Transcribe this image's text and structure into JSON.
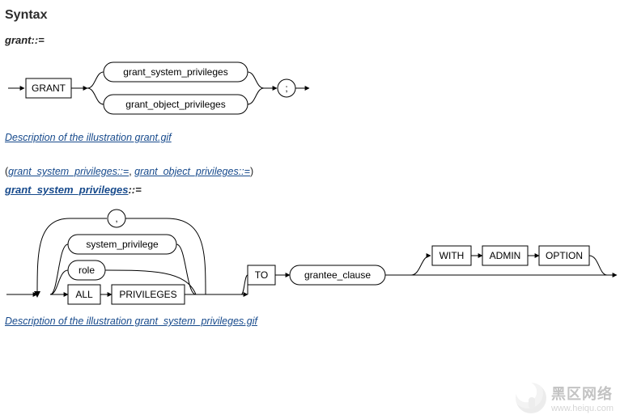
{
  "heading": "Syntax",
  "rule1": {
    "label_name": "grant",
    "label_sep": "::=",
    "keyword": "GRANT",
    "branch_top": "grant_system_privileges",
    "branch_bot": "grant_object_privileges",
    "terminator": ";",
    "desc_link": "Description of the illustration grant.gif"
  },
  "paren_refs": {
    "open": "(",
    "link1": "grant_system_privileges::=",
    "sep": ", ",
    "link2": "grant_object_privileges::=",
    "close": ")"
  },
  "rule2": {
    "label_name": "grant_system_privileges",
    "label_sep": "::=",
    "loop_sep": ",",
    "alt1": "system_privilege",
    "alt2": "role",
    "alt3a": "ALL",
    "alt3b": "PRIVILEGES",
    "to": "TO",
    "grantee": "grantee_clause",
    "opt1": "WITH",
    "opt2": "ADMIN",
    "opt3": "OPTION",
    "desc_link": "Description of the illustration grant_system_privileges.gif"
  },
  "watermark": {
    "line1": "黑区网络",
    "line2": "www.heiqu.com"
  }
}
